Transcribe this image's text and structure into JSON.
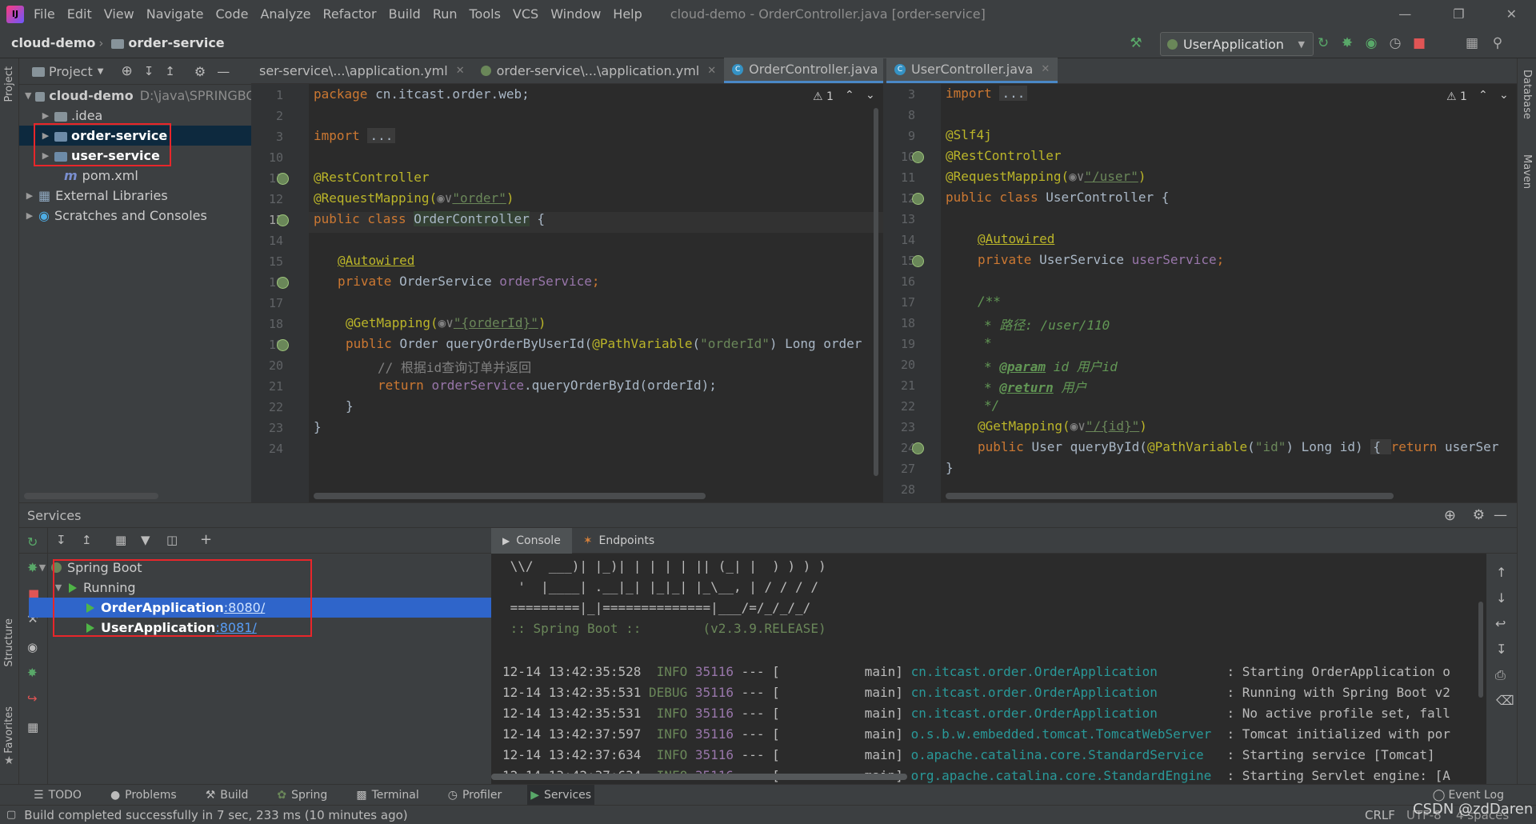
{
  "menubar": {
    "items": [
      "File",
      "Edit",
      "View",
      "Navigate",
      "Code",
      "Analyze",
      "Refactor",
      "Build",
      "Run",
      "Tools",
      "VCS",
      "Window",
      "Help"
    ],
    "window_title": "cloud-demo - OrderController.java [order-service]",
    "logo": "IJ"
  },
  "navbar": {
    "crumb_project": "cloud-demo",
    "crumb_module": "order-service",
    "run_config": "UserApplication"
  },
  "left_strip": {
    "project": "Project",
    "structure": "Structure",
    "favorites": "Favorites"
  },
  "right_strip": {
    "database": "Database",
    "maven": "Maven"
  },
  "project_panel": {
    "title": "Project",
    "root": "cloud-demo",
    "root_path": "D:\\java\\SPRINGBO",
    "items": [
      ".idea",
      "order-service",
      "user-service",
      "pom.xml",
      "External Libraries",
      "Scratches and Consoles"
    ]
  },
  "left_tabs": [
    "ser-service\\...\\application.yml",
    "order-service\\...\\application.yml",
    "OrderController.java"
  ],
  "right_tabs": [
    "UserController.java"
  ],
  "left_editor": {
    "warn": "1",
    "lines": [
      "1",
      "2",
      "3",
      "10",
      "11",
      "12",
      "13",
      "14",
      "15",
      "16",
      "17",
      "18",
      "19",
      "20",
      "21",
      "22",
      "23",
      "24"
    ],
    "code": {
      "l1_kw": "package ",
      "l1_rest": "cn.itcast.order.web;",
      "l3_kw": "import ",
      "l3_fold": "...",
      "l11": "@RestController",
      "l12_ann": "@RequestMapping(",
      "l12_glyph": "◉∨",
      "l12_str": "\"order\"",
      "l12_end": ")",
      "l13_kw": "public class ",
      "l13_name": "OrderController",
      "l13_end": " {",
      "l15": "@Autowired",
      "l16_kw": "private ",
      "l16_type": "OrderService ",
      "l16_field": "orderService",
      "l16_end": ";",
      "l18_ann": "@GetMapping(",
      "l18_glyph": "◉∨",
      "l18_str": "\"{orderId}\"",
      "l18_end": ")",
      "l19_kw": "public ",
      "l19_a": "Order queryOrderByUserId(",
      "l19_ann": "@PathVariable",
      "l19_b": "(",
      "l19_str": "\"orderId\"",
      "l19_c": ") Long order",
      "l20": "// 根据id查询订单并返回",
      "l21_kw": "return ",
      "l21_field": "orderService",
      "l21_rest": ".queryOrderById(orderId);",
      "l22": "}",
      "l23": "}"
    }
  },
  "right_editor": {
    "warn": "1",
    "lines": [
      "3",
      "8",
      "9",
      "10",
      "11",
      "12",
      "13",
      "14",
      "15",
      "16",
      "17",
      "18",
      "19",
      "20",
      "21",
      "22",
      "23",
      "24",
      "27",
      "28"
    ],
    "code": {
      "l3_kw": "import ",
      "l3_fold": "...",
      "l9": "@Slf4j",
      "l10": "@RestController",
      "l11_ann": "@RequestMapping(",
      "l11_glyph": "◉∨",
      "l11_str": "\"/user\"",
      "l11_end": ")",
      "l12_kw": "public class ",
      "l12_rest": "UserController {",
      "l14": "@Autowired",
      "l15_kw": "private ",
      "l15_type": "UserService ",
      "l15_field": "userService",
      "l15_end": ";",
      "l17": "/**",
      "l18": "* 路径: /user/110",
      "l19": "*",
      "l20_a": "* ",
      "l20_tag": "@param",
      "l20_b": " id 用户id",
      "l21_a": "* ",
      "l21_tag": "@return",
      "l21_b": " 用户",
      "l22": "*/",
      "l23_ann": "@GetMapping(",
      "l23_glyph": "◉∨",
      "l23_str": "\"/{id}\"",
      "l23_end": ")",
      "l24_kw": "public ",
      "l24_a": "User queryById(",
      "l24_ann": "@PathVariable",
      "l24_b": "(",
      "l24_str": "\"id\"",
      "l24_c": ") Long id) ",
      "l24_fold": "{ ",
      "l24_kw2": "return ",
      "l24_d": "userSer",
      "l27": "}"
    }
  },
  "services": {
    "title": "Services",
    "tree": {
      "root": "Spring Boot",
      "group": "Running",
      "apps": [
        {
          "name": "OrderApplication",
          "port": ":8080/"
        },
        {
          "name": "UserApplication",
          "port": ":8081/"
        }
      ]
    },
    "tabs": [
      "Console",
      "Endpoints"
    ]
  },
  "console": {
    "banner": [
      " \\\\/  ___)| |_)| | | | | || (_| |  ) ) ) )",
      "  '  |____| .__|_| |_|_| |_\\__, | / / / /",
      " =========|_|==============|___/=/_/_/_/",
      " :: Spring Boot ::        (v2.3.9.RELEASE)"
    ],
    "logs": [
      {
        "ts": "12-14 13:42:35:528",
        "level": " INFO",
        "pid": "35116",
        "mid": " --- [           main] ",
        "logger": "cn.itcast.order.OrderApplication        ",
        "msg": " : Starting OrderApplication o"
      },
      {
        "ts": "12-14 13:42:35:531",
        "level": "DEBUG",
        "pid": "35116",
        "mid": " --- [           main] ",
        "logger": "cn.itcast.order.OrderApplication        ",
        "msg": " : Running with Spring Boot v2"
      },
      {
        "ts": "12-14 13:42:35:531",
        "level": " INFO",
        "pid": "35116",
        "mid": " --- [           main] ",
        "logger": "cn.itcast.order.OrderApplication        ",
        "msg": " : No active profile set, fall"
      },
      {
        "ts": "12-14 13:42:37:597",
        "level": " INFO",
        "pid": "35116",
        "mid": " --- [           main] ",
        "logger": "o.s.b.w.embedded.tomcat.TomcatWebServer ",
        "msg": " : Tomcat initialized with por"
      },
      {
        "ts": "12-14 13:42:37:634",
        "level": " INFO",
        "pid": "35116",
        "mid": " --- [           main] ",
        "logger": "o.apache.catalina.core.StandardService  ",
        "msg": " : Starting service [Tomcat]"
      },
      {
        "ts": "12-14 13:42:37:634",
        "level": " INFO",
        "pid": "35116",
        "mid": " --- [           main] ",
        "logger": "org.apache.catalina.core.StandardEngine ",
        "msg": " : Starting Servlet engine: [A"
      }
    ]
  },
  "toolwindows": [
    "TODO",
    "Problems",
    "Build",
    "Spring",
    "Terminal",
    "Profiler",
    "Services"
  ],
  "event_log": "Event Log",
  "status": {
    "message": "Build completed successfully in 7 sec, 233 ms (10 minutes ago)",
    "line_sep": "CRLF",
    "encoding": "UTF-8",
    "indent": "4 spaces",
    "watermark": "CSDN @zdDaren"
  },
  "colors": {
    "accent": "#4a88c7",
    "highlight_box": "#e8262a",
    "selection": "#2f65ca"
  }
}
